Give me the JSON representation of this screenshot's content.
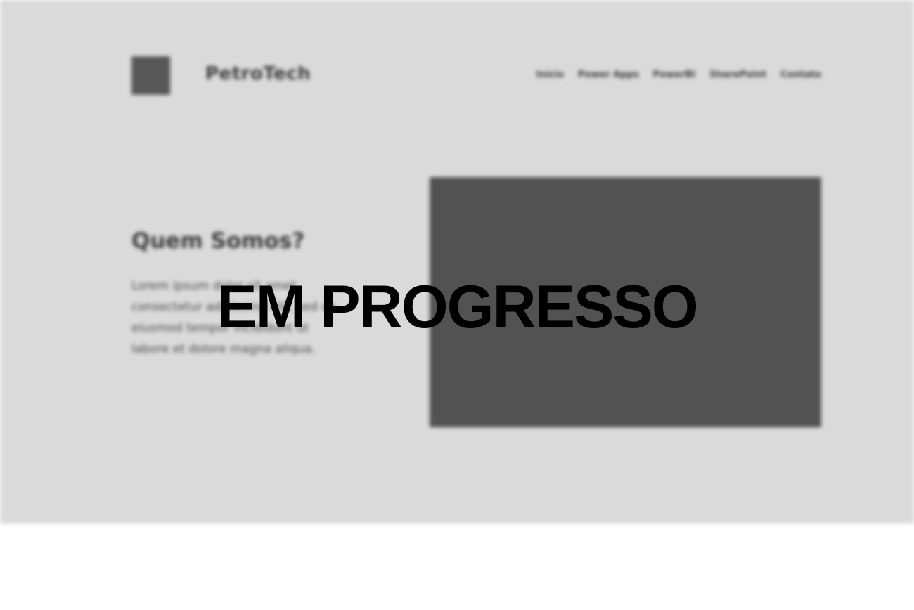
{
  "header": {
    "brand_name": "PetroTech",
    "nav_items": [
      {
        "label": "Início"
      },
      {
        "label": "Power Apps"
      },
      {
        "label": "PowerBI"
      },
      {
        "label": "SharePoint"
      },
      {
        "label": "Contato"
      }
    ]
  },
  "hero": {
    "title": "Quem Somos?",
    "description": "Lorem ipsum dolor sit amet, consectetur adipiscing elit, sed do eiusmod tempor incididunt ut labore et dolore magna aliqua."
  },
  "overlay": {
    "text": "EM PROGRESSO"
  },
  "colors": {
    "hero_background": "#dadada",
    "placeholder_dark": "#525252",
    "overlay_text": "#000000"
  }
}
